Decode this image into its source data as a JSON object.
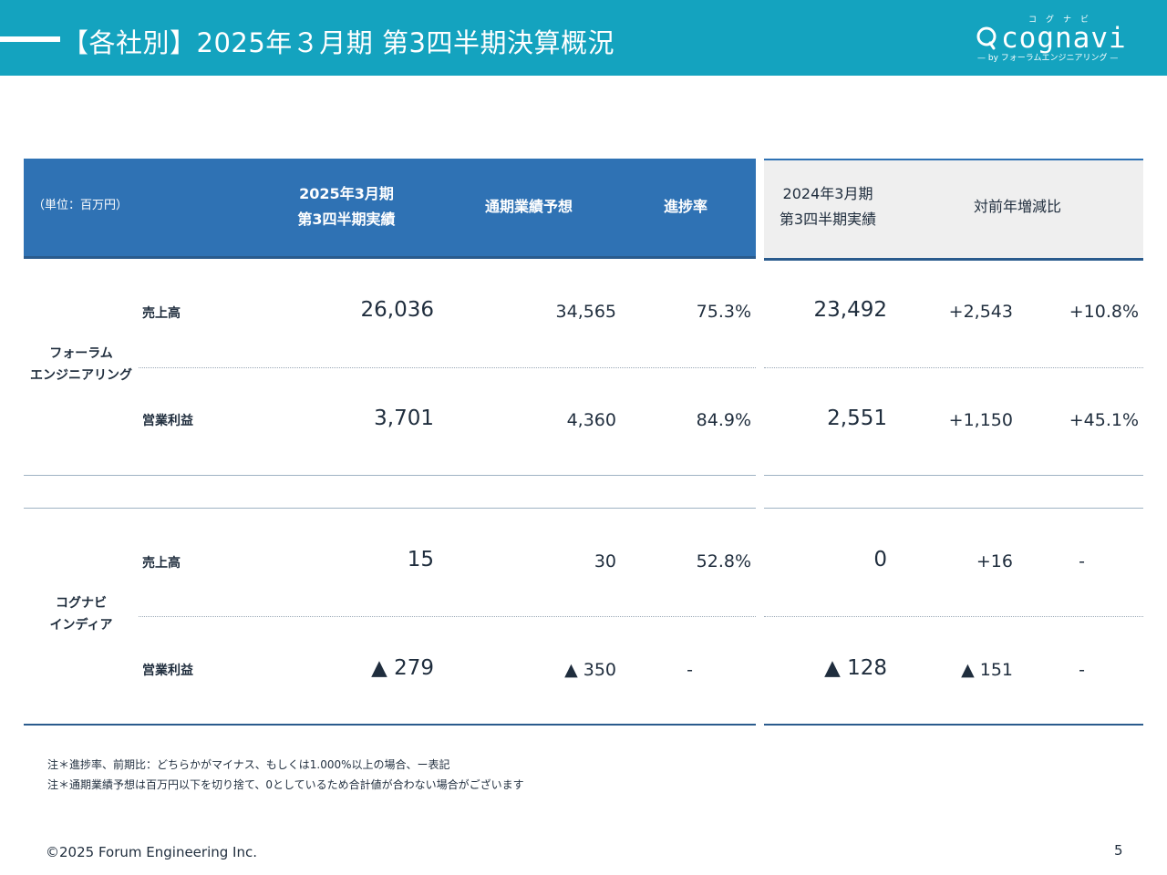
{
  "header": {
    "title": "【各社別】2025年３月期 第3四半期決算概況"
  },
  "logo": {
    "kana": "コグナビ",
    "word": "cognavi",
    "sub": "— by フォーラムエンジニアリング —"
  },
  "table": {
    "unit": "（単位：百万円）",
    "col_current_1": "2025年3月期",
    "col_current_2": "第3四半期実績",
    "col_forecast": "通期業績予想",
    "col_progress": "進捗率",
    "col_prev_1": "2024年3月期",
    "col_prev_2": "第3四半期実績",
    "col_yoy": "対前年増減比",
    "companies": [
      {
        "name_1": "フォーラム",
        "name_2": "エンジニアリング",
        "rows": [
          {
            "label": "売上高",
            "current": "26,036",
            "forecast": "34,565",
            "progress": "75.3%",
            "prev": "23,492",
            "diff": "+2,543",
            "ratio": "+10.8%"
          },
          {
            "label": "営業利益",
            "current": "3,701",
            "forecast": "4,360",
            "progress": "84.9%",
            "prev": "2,551",
            "diff": "+1,150",
            "ratio": "+45.1%"
          }
        ]
      },
      {
        "name_1": "コグナビ",
        "name_2": "インディア",
        "rows": [
          {
            "label": "売上高",
            "current": "15",
            "forecast": "30",
            "progress": "52.8%",
            "prev": "0",
            "diff": "+16",
            "ratio": "-"
          },
          {
            "label": "営業利益",
            "current": "▲ 279",
            "forecast": "▲ 350",
            "progress": "-",
            "prev": "▲ 128",
            "diff": "▲ 151",
            "ratio": "-"
          }
        ]
      }
    ]
  },
  "notes": [
    "注＊進捗率、前期比：どちらかがマイナス、もしくは1.000%以上の場合、ー表記",
    "注＊通期業績予想は百万円以下を切り捨て、0としているため合計値が合わない場合がございます"
  ],
  "footer": {
    "copyright": "©2025 Forum Engineering Inc.",
    "page": "5"
  },
  "colors": {
    "header_bg": "#14a3bf",
    "table_header_blue": "#2f72b4",
    "table_header_gray": "#efefef",
    "rule": "#2a5b8d"
  }
}
